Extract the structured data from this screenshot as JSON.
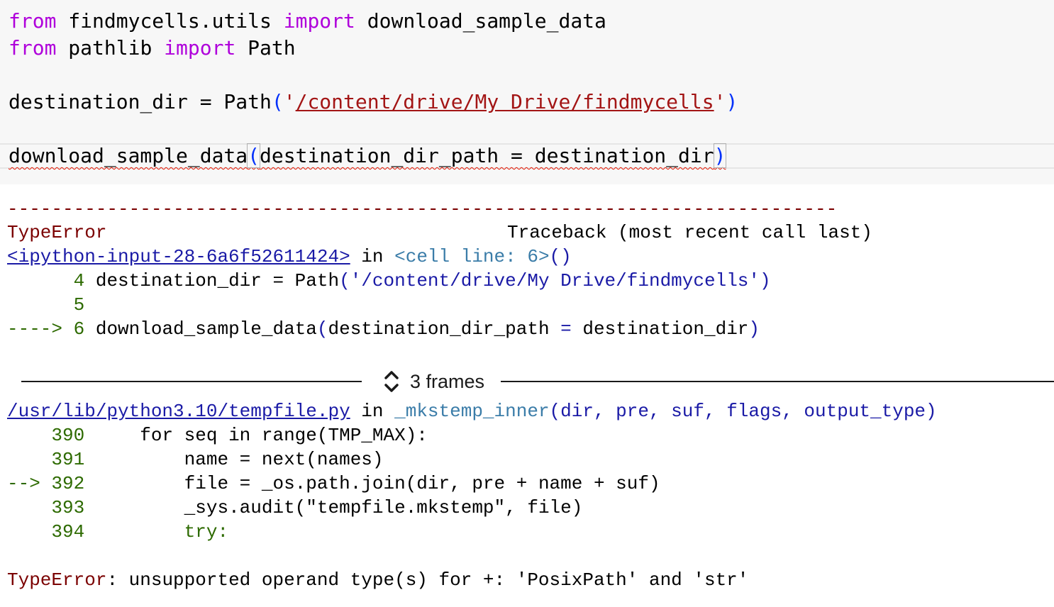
{
  "editor": {
    "line1": {
      "kw1": "from",
      "mod": " findmycells.utils ",
      "kw2": "import",
      "name": " download_sample_data"
    },
    "line2": {
      "kw1": "from",
      "mod": " pathlib ",
      "kw2": "import",
      "name": " Path"
    },
    "line3": {
      "pre": "destination_dir = Path",
      "open": "(",
      "q1": "'",
      "path": "/content/drive/My Drive/findmycells",
      "q2": "'",
      "close": ")"
    },
    "line4": {
      "func": "download_sample_data",
      "open": "(",
      "args": "destination_dir_path = destination_dir",
      "close": ")"
    }
  },
  "output": {
    "separator": "---------------------------------------------------------------------------",
    "error_type": "TypeError",
    "traceback_header": "Traceback (most recent call last)",
    "frame1": {
      "link": "<ipython-input-28-6a6f52611424>",
      "in": " in ",
      "cell": "<cell line: 6>",
      "parens": "()"
    },
    "frame1_lines": [
      {
        "marker": "      ",
        "num": "4",
        "pre": " destination_dir = Path",
        "open": "(",
        "str": "'/content/drive/My Drive/findmycells'",
        "close": ")"
      },
      {
        "marker": "      ",
        "num": "5"
      },
      {
        "marker": "----> ",
        "num": "6",
        "pre": " download_sample_data",
        "open": "(",
        "mid": "destination_dir_path ",
        "eq": "=",
        "post": " destination_dir",
        "close": ")"
      }
    ],
    "frames_label": "3 frames",
    "frame2": {
      "link": "/usr/lib/python3.10/tempfile.py",
      "in": " in ",
      "func": "_mkstemp_inner",
      "args": "(dir, pre, suf, flags, output_type)"
    },
    "frame2_lines": [
      {
        "marker": "    ",
        "num": "390",
        "code": "     for seq in range(TMP_MAX):"
      },
      {
        "marker": "    ",
        "num": "391",
        "code": "         name = next(names)"
      },
      {
        "marker": "--> ",
        "num": "392",
        "code": "         file = _os.path.join(dir, pre + name + suf)"
      },
      {
        "marker": "    ",
        "num": "393",
        "code": "         _sys.audit(\"tempfile.mkstemp\", file)"
      },
      {
        "marker": "    ",
        "num": "394",
        "code": "         try:"
      }
    ],
    "final_error_type": "TypeError",
    "final_error_msg": ": unsupported operand type(s) for +: 'PosixPath' and 'str'"
  },
  "colors": {
    "keyword": "#af00db",
    "string": "#a31515",
    "error": "#7b0000",
    "link": "#1a1aa6",
    "lineno": "#2d6a00"
  },
  "icons": {
    "frames_toggle": "chevron-up-down-icon"
  }
}
